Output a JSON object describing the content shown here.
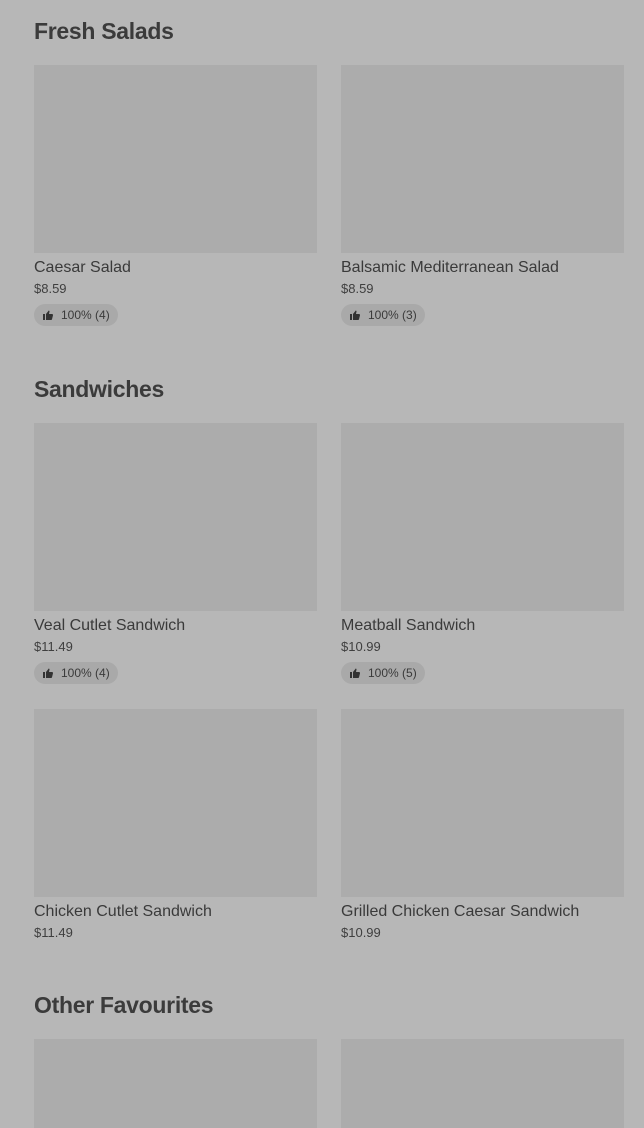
{
  "sections": [
    {
      "title": "Fresh Salads",
      "items": [
        {
          "name": "Caesar Salad",
          "price": "$8.59",
          "rating": "100% (4)"
        },
        {
          "name": "Balsamic Mediterranean Salad",
          "price": "$8.59",
          "rating": "100% (3)"
        }
      ]
    },
    {
      "title": "Sandwiches",
      "items": [
        {
          "name": "Veal Cutlet Sandwich",
          "price": "$11.49",
          "rating": "100% (4)"
        },
        {
          "name": "Meatball Sandwich",
          "price": "$10.99",
          "rating": "100% (5)"
        },
        {
          "name": "Chicken Cutlet Sandwich",
          "price": "$11.49"
        },
        {
          "name": "Grilled Chicken Caesar Sandwich",
          "price": "$10.99"
        }
      ]
    },
    {
      "title": "Other Favourites"
    }
  ],
  "icons": {
    "rating": "thumbs-up-icon"
  }
}
